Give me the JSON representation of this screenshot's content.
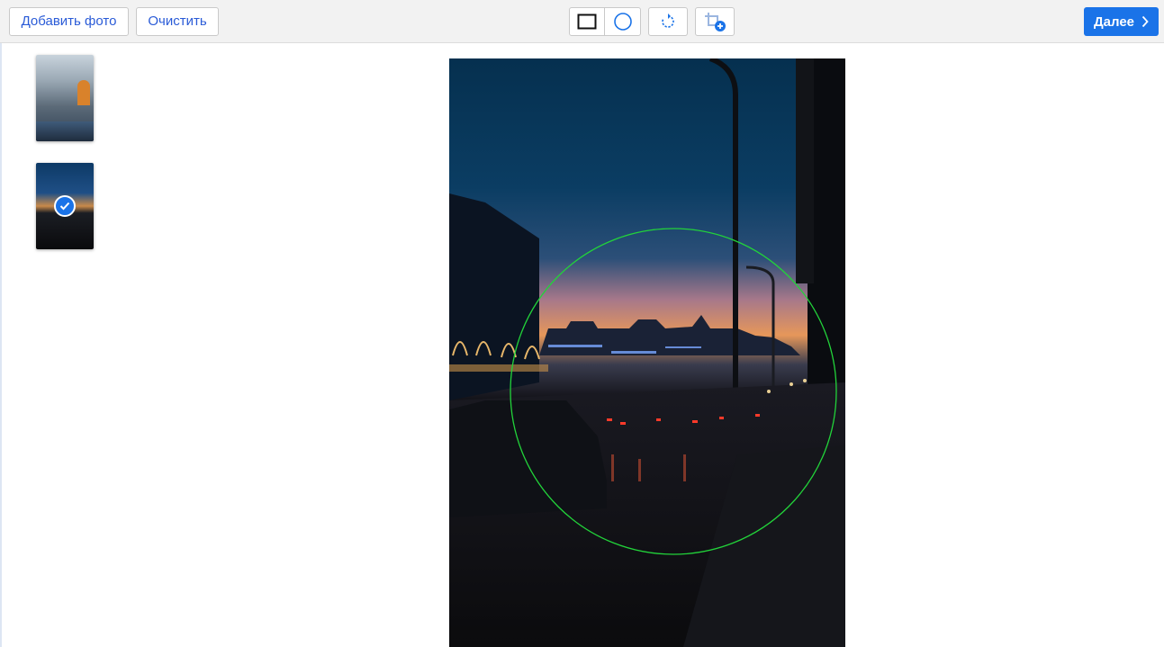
{
  "toolbar": {
    "add_photo_label": "Добавить фото",
    "clear_label": "Очистить",
    "next_label": "Далее",
    "shape_tools": [
      "rectangle-icon",
      "circle-icon"
    ],
    "rotate_icon": "rotate-icon",
    "crop_add_icon": "crop-add-icon"
  },
  "thumbnails": [
    {
      "name": "photo-thumbnail-1",
      "selected": false
    },
    {
      "name": "photo-thumbnail-2",
      "selected": true
    }
  ],
  "editor": {
    "selection_shape": "circle",
    "selection_color": "#22d33a"
  },
  "colors": {
    "accent": "#1a73e8",
    "toolbar_bg": "#f2f2f2",
    "button_text": "#2a5bd7"
  }
}
